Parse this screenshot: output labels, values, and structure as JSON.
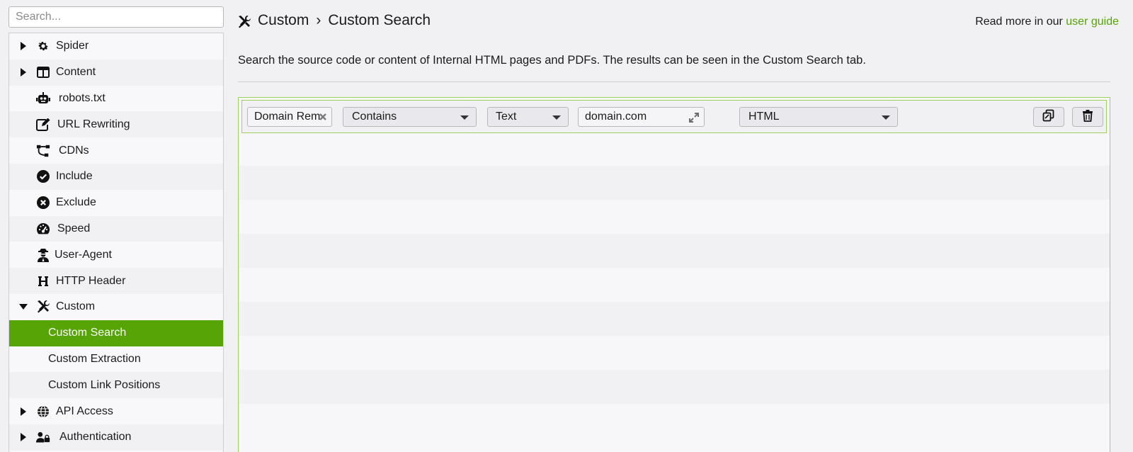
{
  "sidebar": {
    "search_placeholder": "Search...",
    "items": [
      {
        "label": "Spider",
        "icon": "gear-icon",
        "caret": "collapsed"
      },
      {
        "label": "Content",
        "icon": "columns-icon",
        "caret": "collapsed"
      },
      {
        "label": "robots.txt",
        "icon": "robot-icon"
      },
      {
        "label": "URL Rewriting",
        "icon": "edit-icon"
      },
      {
        "label": "CDNs",
        "icon": "network-icon"
      },
      {
        "label": "Include",
        "icon": "check-circle-icon"
      },
      {
        "label": "Exclude",
        "icon": "x-circle-icon"
      },
      {
        "label": "Speed",
        "icon": "gauge-icon"
      },
      {
        "label": "User-Agent",
        "icon": "user-secret-icon"
      },
      {
        "label": "HTTP Header",
        "icon": "heading-icon"
      },
      {
        "label": "Custom",
        "icon": "tools-icon",
        "caret": "expanded"
      },
      {
        "label": "Custom Search",
        "selected": true
      },
      {
        "label": "Custom Extraction"
      },
      {
        "label": "Custom Link Positions"
      },
      {
        "label": "API Access",
        "icon": "globe-icon",
        "caret": "collapsed"
      },
      {
        "label": "Authentication",
        "icon": "user-lock-icon",
        "caret": "collapsed"
      }
    ]
  },
  "header": {
    "crumb_1": "Custom",
    "separator": "›",
    "crumb_2": "Custom Search",
    "read_more_prefix": "Read more in our",
    "read_more_link": "user guide",
    "description": "Search the source code or content of Internal HTML pages and PDFs. The results can be seen in the Custom Search tab."
  },
  "rule": {
    "name_value": "Domain Rem",
    "operator_value": "Contains",
    "type_value": "Text",
    "search_value": "domain.com",
    "scope_value": "HTML"
  },
  "colors": {
    "accent": "#56a406",
    "panel_border": "#9fd25d",
    "background": "#f1f0f3"
  }
}
